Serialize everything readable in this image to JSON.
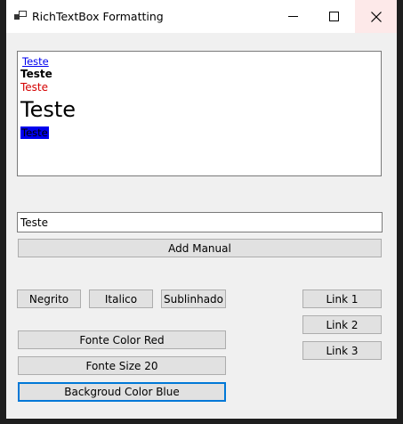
{
  "window": {
    "title": "RichTextBox Formatting",
    "controls": {
      "minimize_icon": "minimize-icon",
      "maximize_icon": "maximize-icon",
      "close_icon": "close-icon"
    }
  },
  "rich_text": {
    "lines": [
      {
        "text": "Teste",
        "style": "link",
        "color": "#0000ee"
      },
      {
        "text": "Teste",
        "style": "bold",
        "color": "#000000"
      },
      {
        "text": "Teste",
        "style": "normal",
        "color": "#d40000"
      },
      {
        "text": "Teste",
        "style": "size-20",
        "color": "#000000"
      },
      {
        "text": "Teste",
        "style": "background-blue",
        "color": "#000000",
        "background": "#0000ee"
      }
    ]
  },
  "input": {
    "value": "Teste"
  },
  "buttons": {
    "add_manual": "Add Manual",
    "negrito": "Negrito",
    "italico": "Italico",
    "sublinhado": "Sublinhado",
    "fonte_color_red": "Fonte Color Red",
    "fonte_size_20": "Fonte Size 20",
    "background_color_blue": "Backgroud Color Blue",
    "link1": "Link 1",
    "link2": "Link 2",
    "link3": "Link 3"
  },
  "colors": {
    "accent": "#0078d7",
    "link": "#0000ee",
    "red": "#d40000",
    "button_bg": "#e1e1e1"
  }
}
